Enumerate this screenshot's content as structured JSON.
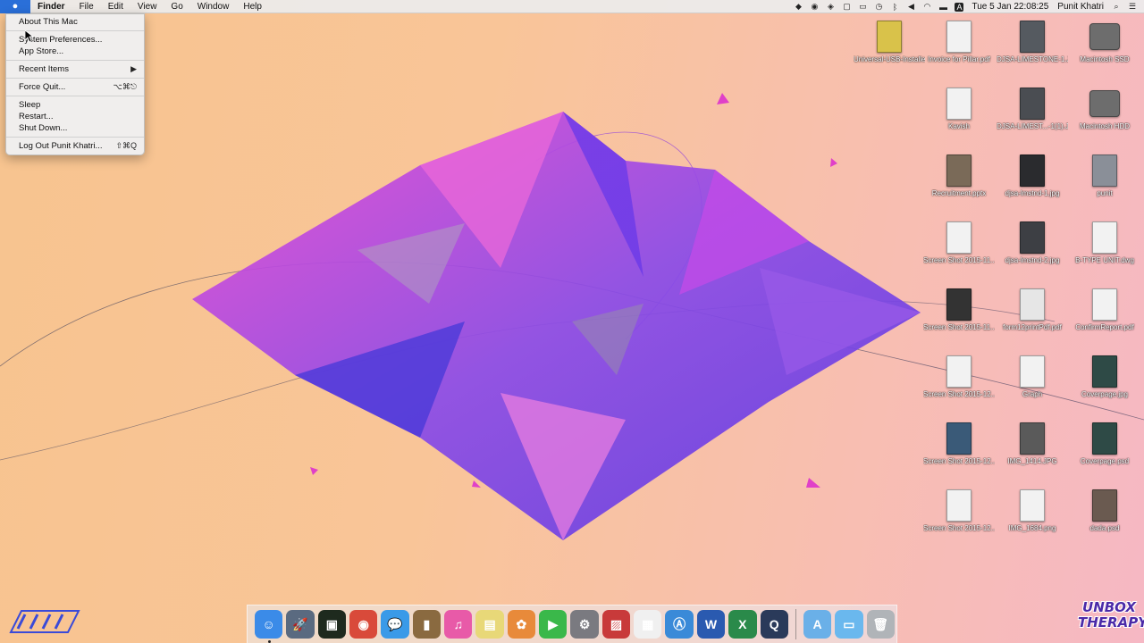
{
  "menubar": {
    "apple_icon": "apple-logo-icon",
    "items": [
      "Finder",
      "File",
      "Edit",
      "View",
      "Go",
      "Window",
      "Help"
    ],
    "status": {
      "datetime": "Tue 5 Jan  22:08:25",
      "user": "Punit Khatri",
      "input_source": "A",
      "icons": [
        "app-icon",
        "record-icon",
        "dropbox-icon",
        "screen-icon",
        "airplay-icon",
        "time-machine-icon",
        "bluetooth-icon",
        "volume-icon",
        "wifi-icon",
        "battery-icon",
        "input-source-icon",
        "spotlight-icon",
        "notification-center-icon"
      ]
    }
  },
  "apple_menu": {
    "items": [
      {
        "label": "About This Mac",
        "shortcut": ""
      },
      {
        "sep": true
      },
      {
        "label": "System Preferences...",
        "shortcut": ""
      },
      {
        "label": "App Store...",
        "shortcut": ""
      },
      {
        "sep": true
      },
      {
        "label": "Recent Items",
        "shortcut": "▶"
      },
      {
        "sep": true
      },
      {
        "label": "Force Quit...",
        "shortcut": "⌥⌘⎋"
      },
      {
        "sep": true
      },
      {
        "label": "Sleep",
        "shortcut": ""
      },
      {
        "label": "Restart...",
        "shortcut": ""
      },
      {
        "label": "Shut Down...",
        "shortcut": ""
      },
      {
        "sep": true
      },
      {
        "label": "Log Out Punit Khatri...",
        "shortcut": "⇧⌘Q"
      }
    ]
  },
  "desktop_icons": [
    {
      "label": "Universal-USB-Installer...6.9.9.exe",
      "icon": "exe-file-icon",
      "color": "#d9c24a"
    },
    {
      "label": "Invoice for Pillar.pdf",
      "icon": "pdf-file-icon",
      "color": "#f2f2f2"
    },
    {
      "label": "DJSA-LIMESTONE-1.JPG",
      "icon": "image-file-icon",
      "color": "#555a60"
    },
    {
      "label": "Macintosh SSD",
      "icon": "hard-drive-icon",
      "color": "#6d6d6d"
    },
    {
      "label": "Kavish",
      "icon": "docx-file-icon",
      "color": "#f2f2f2"
    },
    {
      "label": "DJSA-LIMEST...-1(1).JPG",
      "icon": "image-file-icon",
      "color": "#4a4d52"
    },
    {
      "label": "Macintosh HDD",
      "icon": "hard-drive-icon",
      "color": "#6d6d6d"
    },
    {
      "label": "Recruitment.pptx",
      "icon": "pptx-file-icon",
      "color": "#7a6a58"
    },
    {
      "label": "djsa-lmstnd-1.jpg",
      "icon": "image-file-icon",
      "color": "#2a2b2e"
    },
    {
      "label": "punit",
      "icon": "user-folder-icon",
      "color": "#8a8f98"
    },
    {
      "label": "Screen Shot 2015-11...08.25 PM",
      "icon": "screenshot-icon",
      "color": "#f2f2f2"
    },
    {
      "label": "djsa-lmstnd-2.jpg",
      "icon": "image-file-icon",
      "color": "#3d3f44"
    },
    {
      "label": "B-TYPE UNIT.dwg",
      "icon": "dwg-file-icon",
      "color": "#f2f2f2"
    },
    {
      "label": "Screen Shot 2015-11...37.49 AM",
      "icon": "screenshot-icon",
      "color": "#333"
    },
    {
      "label": "form12printPdf.pdf",
      "icon": "pdf-file-icon",
      "color": "#e6e6e6"
    },
    {
      "label": "ConfirmReport.pdf",
      "icon": "pdf-file-icon",
      "color": "#f2f2f2"
    },
    {
      "label": "Screen Shot 2015-12...2.49 PM",
      "icon": "screenshot-icon",
      "color": "#f2f2f2"
    },
    {
      "label": "Graph",
      "icon": "xlsx-file-icon",
      "color": "#f2f2f2"
    },
    {
      "label": "Coverpage.jpg",
      "icon": "image-file-icon",
      "color": "#2e4a46"
    },
    {
      "label": "Screen Shot 2015-12...14.06 PM",
      "icon": "screenshot-icon",
      "color": "#3a5a78"
    },
    {
      "label": "IMG_1414.JPG",
      "icon": "image-file-icon",
      "color": "#5a5a5a"
    },
    {
      "label": "Coverpage.psd",
      "icon": "psd-file-icon",
      "color": "#2e4a46"
    },
    {
      "label": "Screen Shot 2015-12...3.23 PM",
      "icon": "screenshot-icon",
      "color": "#f2f2f2"
    },
    {
      "label": "IMG_1684.png",
      "icon": "image-file-icon",
      "color": "#f2f2f2"
    },
    {
      "label": "dada.psd",
      "icon": "psd-file-icon",
      "color": "#6a5a50"
    }
  ],
  "dock": {
    "apps": [
      {
        "name": "finder-icon",
        "color": "#3b8be8",
        "glyph": "☺"
      },
      {
        "name": "launchpad-icon",
        "color": "#5a6a80",
        "glyph": "🚀"
      },
      {
        "name": "terminal-icon",
        "color": "#1e2a1e",
        "glyph": "▣"
      },
      {
        "name": "chrome-icon",
        "color": "#d94a3a",
        "glyph": "◉"
      },
      {
        "name": "messages-icon",
        "color": "#3a9ae8",
        "glyph": "💬"
      },
      {
        "name": "notefile-icon",
        "color": "#8a6a40",
        "glyph": "▮"
      },
      {
        "name": "itunes-icon",
        "color": "#e85aa8",
        "glyph": "♫"
      },
      {
        "name": "notes-icon",
        "color": "#e8d878",
        "glyph": "▤"
      },
      {
        "name": "photos-icon",
        "color": "#e88a3a",
        "glyph": "✿"
      },
      {
        "name": "facetime-icon",
        "color": "#3ab84a",
        "glyph": "▶"
      },
      {
        "name": "system-preferences-icon",
        "color": "#7a7a80",
        "glyph": "⚙"
      },
      {
        "name": "photo-booth-icon",
        "color": "#c83a3a",
        "glyph": "▨"
      },
      {
        "name": "calculator-grid-icon",
        "color": "#f0f0f0",
        "glyph": "▦"
      },
      {
        "name": "app-store-icon",
        "color": "#3a8ad8",
        "glyph": "Ⓐ"
      },
      {
        "name": "word-icon",
        "color": "#2a5ab0",
        "glyph": "W"
      },
      {
        "name": "excel-icon",
        "color": "#2a8a4a",
        "glyph": "X"
      },
      {
        "name": "quicktime-icon",
        "color": "#2a3a5a",
        "glyph": "Q"
      }
    ],
    "stacks": [
      {
        "name": "applications-folder-icon",
        "color": "#6ab0e8",
        "glyph": "A"
      },
      {
        "name": "documents-folder-icon",
        "color": "#6ab8ee",
        "glyph": "▭"
      },
      {
        "name": "trash-icon",
        "color": "#b0b4b8",
        "glyph": "🗑"
      }
    ]
  },
  "watermark_right": [
    "UNBOX",
    "THERAPY"
  ]
}
